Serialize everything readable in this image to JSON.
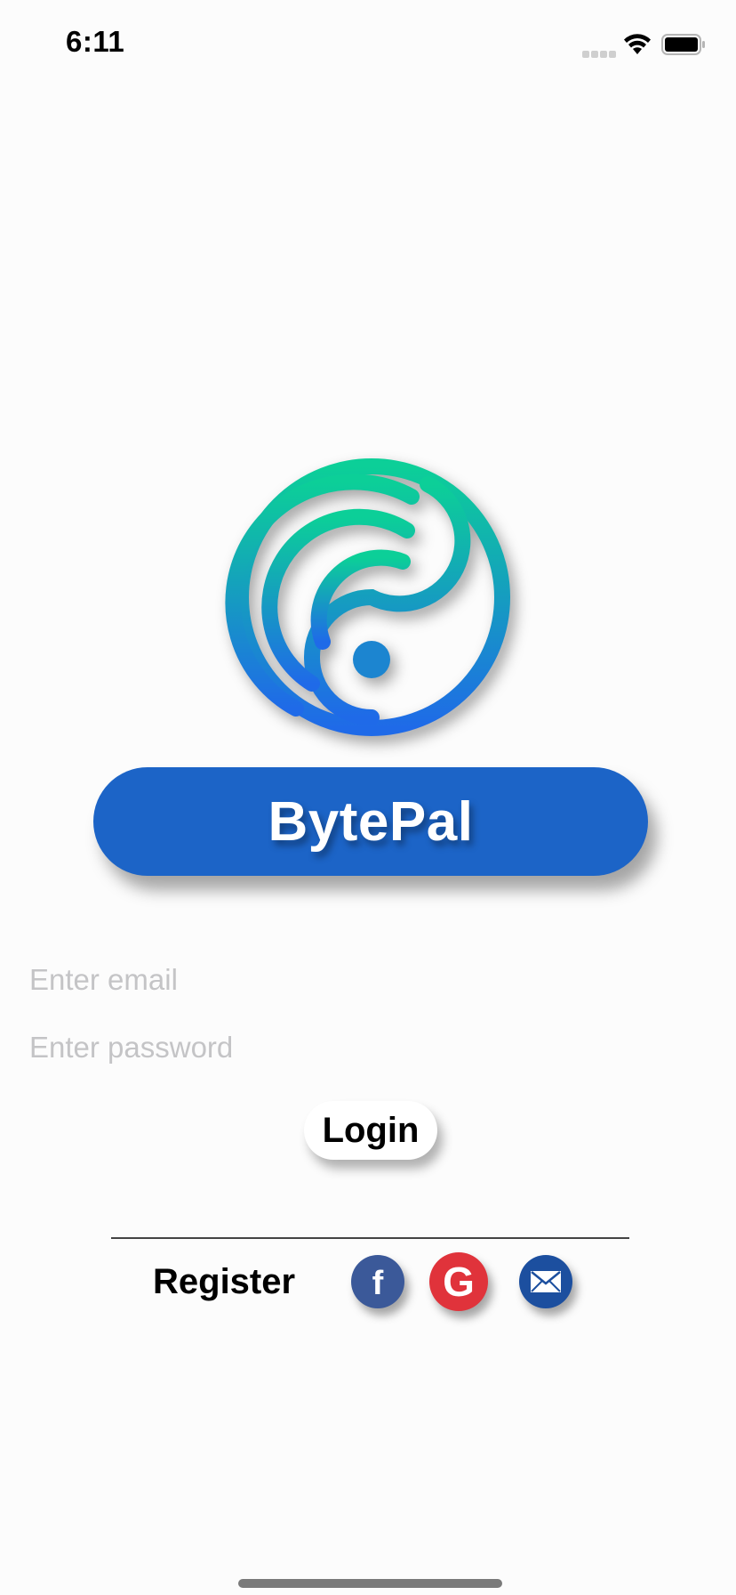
{
  "status_bar": {
    "time": "6:11"
  },
  "brand": {
    "title": "BytePal",
    "logo_icon": "spiral-circle-logo-icon",
    "logo_gradient": [
      "#0ccf98",
      "#1f6ae8"
    ],
    "pill_color": "#1c64c7"
  },
  "form": {
    "email_placeholder": "Enter email",
    "password_placeholder": "Enter password",
    "login_label": "Login"
  },
  "footer": {
    "register_label": "Register",
    "social": [
      {
        "name": "facebook",
        "glyph": "f",
        "color": "#3b5999",
        "icon": "facebook-icon"
      },
      {
        "name": "google",
        "glyph": "G",
        "color": "#e0333b",
        "icon": "google-icon"
      },
      {
        "name": "email",
        "glyph": "envelope",
        "color": "#1c4f9f",
        "icon": "envelope-icon"
      }
    ]
  }
}
